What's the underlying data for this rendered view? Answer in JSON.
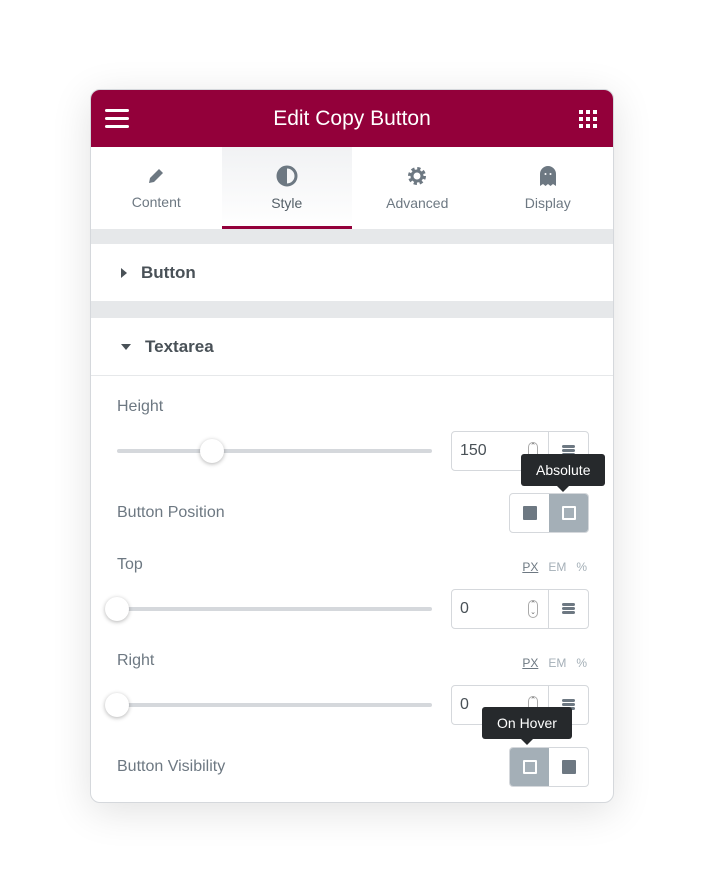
{
  "header": {
    "title": "Edit Copy Button",
    "menu_icon": "hamburger-icon",
    "apps_icon": "grid-icon"
  },
  "tabs": [
    {
      "label": "Content",
      "icon": "pencil-icon"
    },
    {
      "label": "Style",
      "icon": "half-circle-icon",
      "active": true
    },
    {
      "label": "Advanced",
      "icon": "gear-icon"
    },
    {
      "label": "Display",
      "icon": "ghost-icon"
    }
  ],
  "sections": {
    "button": "Button",
    "textarea": "Textarea"
  },
  "controls": {
    "height": {
      "label": "Height",
      "value": "150",
      "slider_percent": 30
    },
    "position": {
      "label": "Button Position",
      "tooltip": "Absolute",
      "selected": "absolute"
    },
    "top": {
      "label": "Top",
      "value": "0",
      "units": [
        "PX",
        "EM",
        "%"
      ],
      "selected_unit": "PX",
      "slider_percent": 0
    },
    "right": {
      "label": "Right",
      "value": "0",
      "units": [
        "PX",
        "EM",
        "%"
      ],
      "selected_unit": "PX",
      "slider_percent": 0
    },
    "visibility": {
      "label": "Button Visibility",
      "tooltip": "On Hover",
      "selected": "on-hover"
    }
  },
  "colors": {
    "brand": "#93003a"
  }
}
